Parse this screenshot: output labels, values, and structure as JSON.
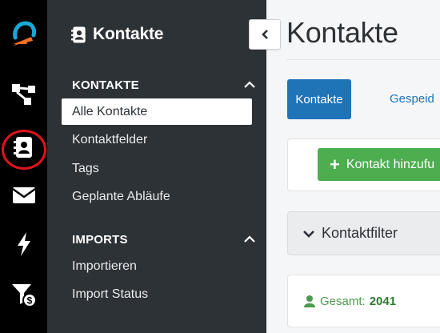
{
  "rail": {
    "items": [
      {
        "name": "logo",
        "icon": "app-logo-icon"
      },
      {
        "name": "workflows",
        "icon": "workflow-icon"
      },
      {
        "name": "contacts",
        "icon": "contact-book-icon",
        "highlighted": true
      },
      {
        "name": "email",
        "icon": "envelope-icon"
      },
      {
        "name": "automations",
        "icon": "lightning-icon"
      },
      {
        "name": "billing-filter",
        "icon": "filter-dollar-icon"
      }
    ],
    "highlight_color": "#e3121b"
  },
  "sidebar": {
    "title": "Kontakte",
    "title_icon": "contact-book-icon",
    "sections": [
      {
        "label": "KONTAKTE",
        "items": [
          {
            "label": "Alle Kontakte",
            "active": true
          },
          {
            "label": "Kontaktfelder"
          },
          {
            "label": "Tags"
          },
          {
            "label": "Geplante Abläufe"
          }
        ]
      },
      {
        "label": "IMPORTS",
        "items": [
          {
            "label": "Importieren"
          },
          {
            "label": "Import Status"
          }
        ]
      }
    ]
  },
  "main": {
    "title": "Kontakte",
    "tabs": {
      "primary": "Kontakte",
      "secondary": "Gespeid"
    },
    "add_button": "Kontakt hinzufu",
    "filter_label": "Kontaktfilter",
    "stats": {
      "label": "Gesamt:",
      "value": "2041"
    }
  },
  "colors": {
    "rail_bg": "#000000",
    "sidebar_bg": "#2d3237",
    "primary": "#1f73b7",
    "success": "#4cae4f",
    "page_bg": "#f5f6f7"
  }
}
